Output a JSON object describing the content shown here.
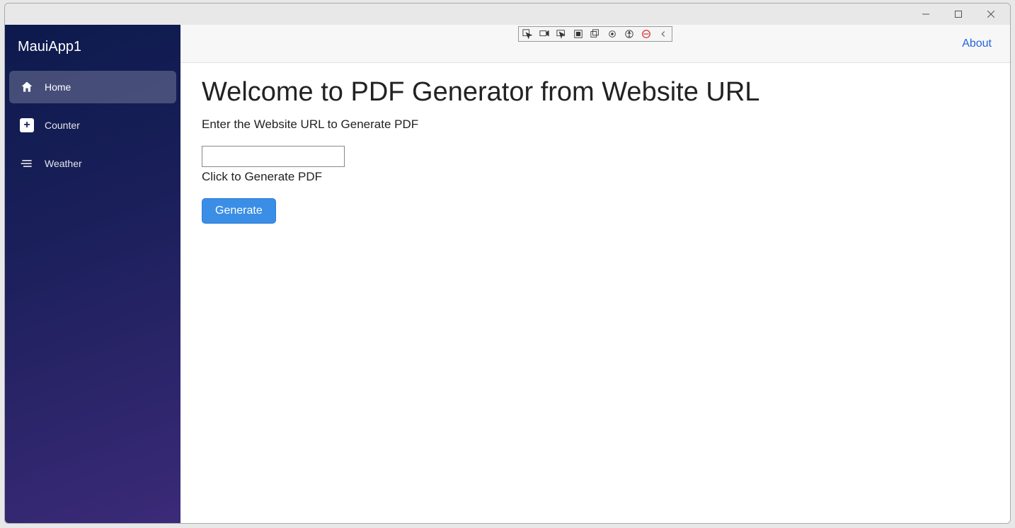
{
  "sidebar": {
    "title": "MauiApp1",
    "items": [
      {
        "label": "Home",
        "icon": "home-icon",
        "active": true
      },
      {
        "label": "Counter",
        "icon": "plus-icon",
        "active": false
      },
      {
        "label": "Weather",
        "icon": "list-icon",
        "active": false
      }
    ]
  },
  "topbar": {
    "about_label": "About"
  },
  "content": {
    "heading": "Welcome to PDF Generator from Website URL",
    "prompt": "Enter the Website URL to Generate PDF",
    "url_value": "",
    "click_label": "Click to Generate PDF",
    "generate_label": "Generate"
  },
  "debug_toolbar": {
    "buttons": [
      "select-element",
      "screencast",
      "inspect",
      "box",
      "layers",
      "target",
      "accessibility",
      "stop",
      "collapse"
    ]
  }
}
